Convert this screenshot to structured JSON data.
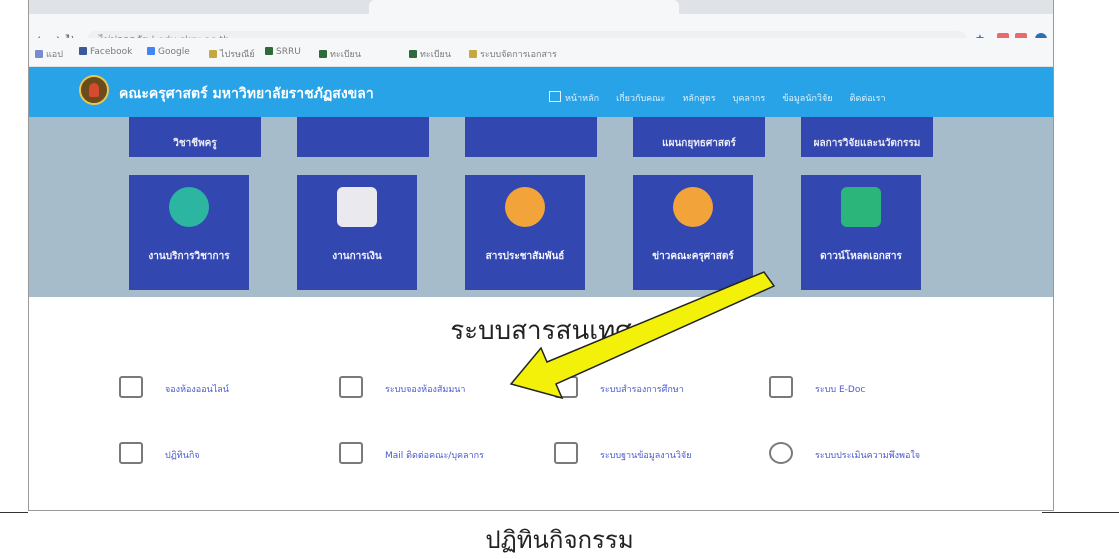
{
  "browser": {
    "url_text": "ไม่ปลอดภัย | edu.skru.ac.th",
    "bookmarks": [
      "แอป",
      "Facebook",
      "Google",
      "ไปรษณีย์",
      "SRRU",
      "ทะเบียน",
      "ทะเบียน",
      "ระบบจัดการเอกสาร"
    ]
  },
  "site": {
    "title": "คณะครุศาสตร์ มหาวิทยาลัยราชภัฏสงขลา",
    "nav": [
      "หน้าหลัก",
      "เกี่ยวกับคณะ",
      "หลักสูตร",
      "บุคลากร",
      "ข้อมูลนักวิจัย",
      "ติดต่อเรา"
    ]
  },
  "tiles_top": [
    "วิชาชีพครู",
    "",
    "",
    "แผนกยุทธศาสตร์",
    "ผลการวิจัยและนวัตกรรม"
  ],
  "tiles": [
    "งานบริการวิชาการ",
    "งานการเงิน",
    "สารประชาสัมพันธ์",
    "ข่าวคณะครุศาสตร์",
    "ดาวน์โหลดเอกสาร"
  ],
  "colors": {
    "accent": "#29a3e8",
    "tile": "#3347b0",
    "band": "#a7bccb",
    "arrow": "#f3f10a"
  },
  "section": {
    "title": "ระบบสารสนเทศ",
    "items": [
      {
        "label": "จองห้องออนไลน์",
        "icon": "pencil-note-icon"
      },
      {
        "label": "ระบบจองห้องสัมมนา",
        "icon": "chat-bubble-icon"
      },
      {
        "label": "ระบบสำรองการศึกษา",
        "icon": "devices-icon"
      },
      {
        "label": "ระบบ E-Doc",
        "icon": "document-list-icon"
      },
      {
        "label": "ปฏิทินกิจ",
        "icon": "calendar-icon"
      },
      {
        "label": "Mail ติดต่อคณะ/บุคลากร",
        "icon": "envelope-icon"
      },
      {
        "label": "ระบบฐานข้อมูลงานวิจัย",
        "icon": "window-icon"
      },
      {
        "label": "ระบบประเมินความพึงพอใจ",
        "icon": "smiley-icon"
      }
    ]
  },
  "caption": "ปฏิทินกิจกรรม"
}
